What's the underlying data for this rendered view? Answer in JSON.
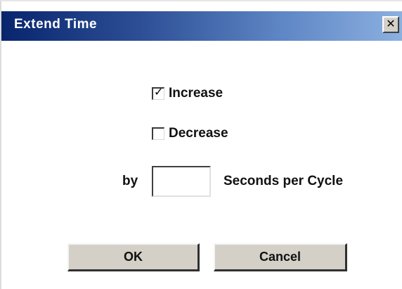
{
  "dialog": {
    "title": "Extend Time",
    "close_glyph": "✕",
    "increase": {
      "label": "Increase",
      "checked": true,
      "check_glyph": "✓"
    },
    "decrease": {
      "label": "Decrease",
      "checked": false
    },
    "by_label": "by",
    "seconds_value": "",
    "units_label": "Seconds per Cycle",
    "ok_label": "OK",
    "cancel_label": "Cancel"
  }
}
